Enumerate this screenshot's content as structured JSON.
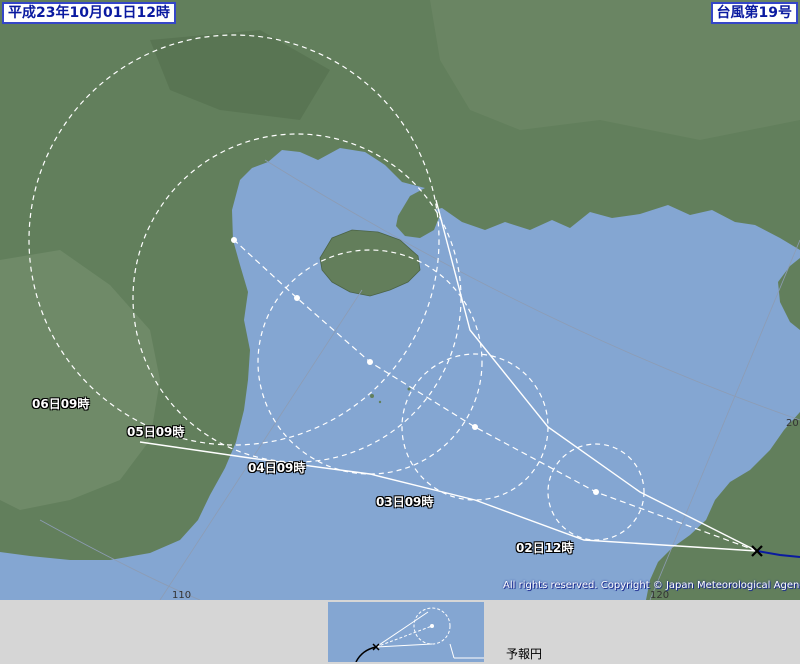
{
  "header": {
    "date": "平成23年10月01日12時",
    "typhoon_name": "台風第19号"
  },
  "forecast_labels": [
    {
      "text": "02日12時"
    },
    {
      "text": "03日09時"
    },
    {
      "text": "04日09時"
    },
    {
      "text": "05日09時"
    },
    {
      "text": "06日09時"
    }
  ],
  "grid_labels": {
    "lon_110": "110",
    "lon_120": "120",
    "lat_20": "20"
  },
  "copyright": "All rights reserved. Copyright © Japan Meteorological Agency",
  "legend": {
    "label": "予報円"
  },
  "colors": {
    "sea": "#84a6d2",
    "land": "#627f5c",
    "header_text": "#0a1aa0",
    "header_border": "#3546c8",
    "forecast_line": "#ffffff",
    "past_track": "#0a1aa0"
  },
  "icons": {
    "current_position": "x-mark",
    "forecast_point": "dot"
  }
}
